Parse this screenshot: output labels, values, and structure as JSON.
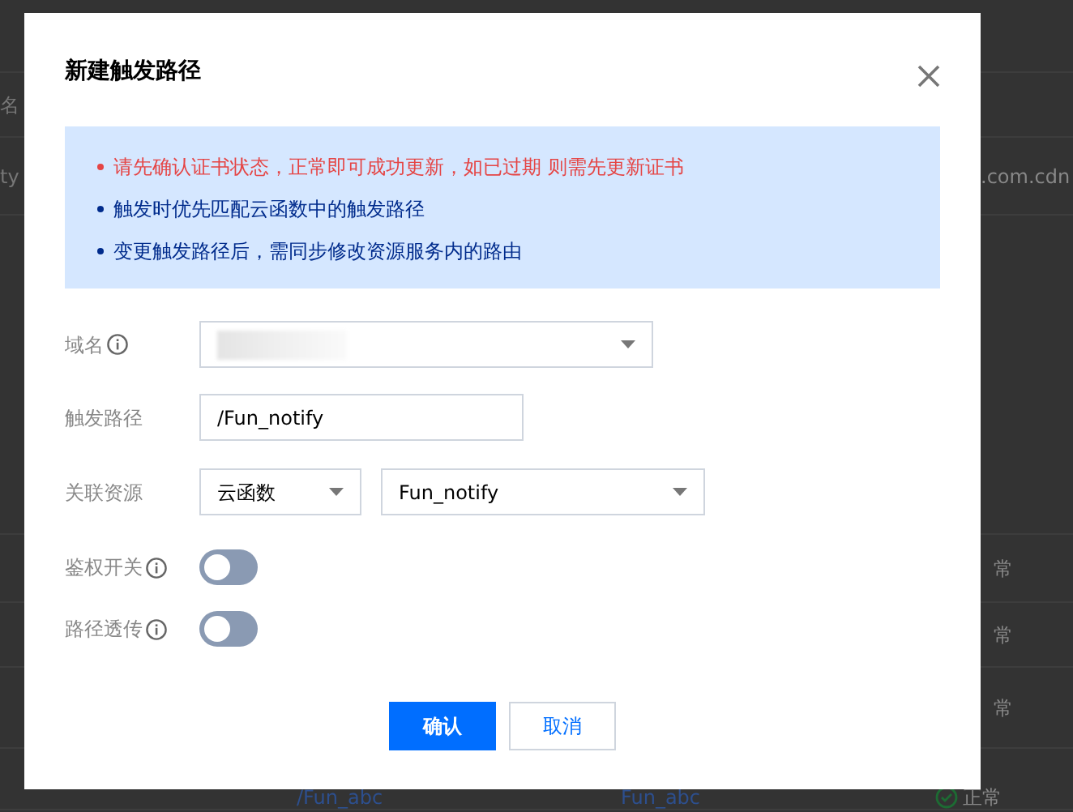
{
  "background": {
    "rows": [
      {
        "left": "名",
        "right": ""
      },
      {
        "left": "ty",
        "right": ".com.cdn"
      },
      {
        "left": "",
        "right": "常"
      },
      {
        "left": "",
        "right": "常"
      },
      {
        "left": "",
        "right": "常"
      }
    ],
    "last_row": {
      "path": "/Fun_abc",
      "resource": "Fun_abc",
      "status": "正常"
    }
  },
  "dialog": {
    "title": "新建触发路径",
    "notices": [
      {
        "text": "请先确认证书状态，正常即可成功更新，如已过期 则需先更新证书",
        "kind": "warning"
      },
      {
        "text": "触发时优先匹配云函数中的触发路径",
        "kind": "info"
      },
      {
        "text": "变更触发路径后，需同步修改资源服务内的路由",
        "kind": "info"
      }
    ],
    "fields": [
      {
        "label": "域名",
        "kind": "redacted-select",
        "info": true
      },
      {
        "label": "触发路径",
        "kind": "input",
        "info": false,
        "value": "/Fun_notify"
      },
      {
        "label": "关联资源",
        "kind": "selects",
        "info": false,
        "values": [
          "云函数",
          "Fun_notify"
        ]
      },
      {
        "label": "鉴权开关",
        "kind": "switch",
        "info": true,
        "on": false
      },
      {
        "label": "路径透传",
        "kind": "switch",
        "info": true,
        "on": false
      }
    ],
    "buttons": [
      {
        "label": "确认",
        "kind": "primary"
      },
      {
        "label": "取消",
        "kind": "secondary"
      }
    ]
  }
}
